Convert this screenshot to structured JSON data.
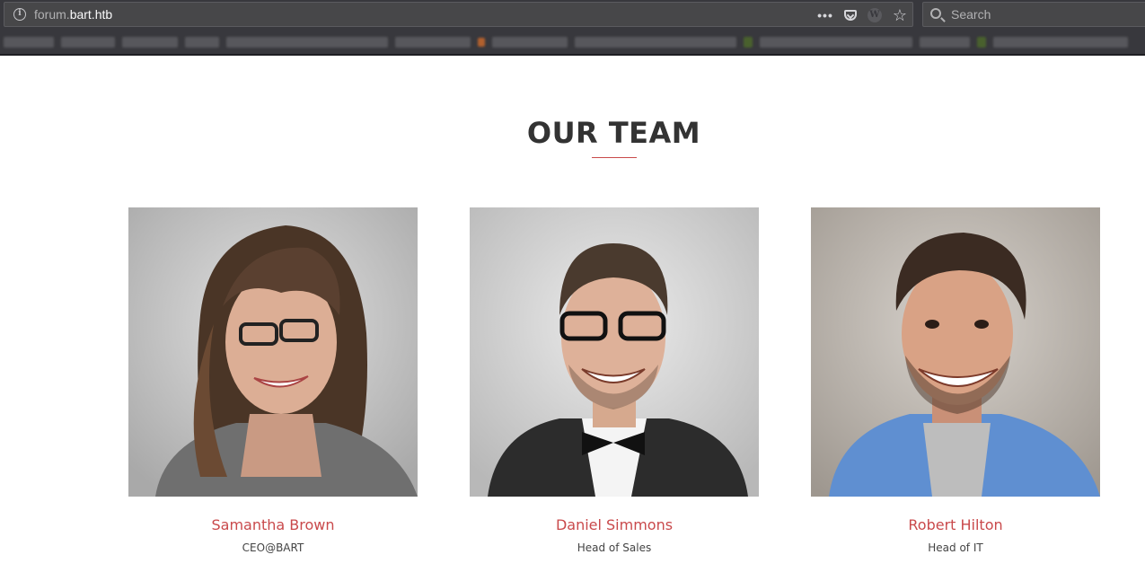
{
  "browser": {
    "url_prefix": "forum.",
    "url_host": "bart.htb",
    "more_label": "•••",
    "search_placeholder": "Search"
  },
  "section": {
    "title": "OUR TEAM"
  },
  "team": [
    {
      "name": "Samantha Brown",
      "role": "CEO@BART"
    },
    {
      "name": "Daniel Simmons",
      "role": "Head of Sales"
    },
    {
      "name": "Robert Hilton",
      "role": "Head of IT"
    }
  ],
  "colors": {
    "accent": "#c9494b",
    "chrome": "#38383d"
  }
}
